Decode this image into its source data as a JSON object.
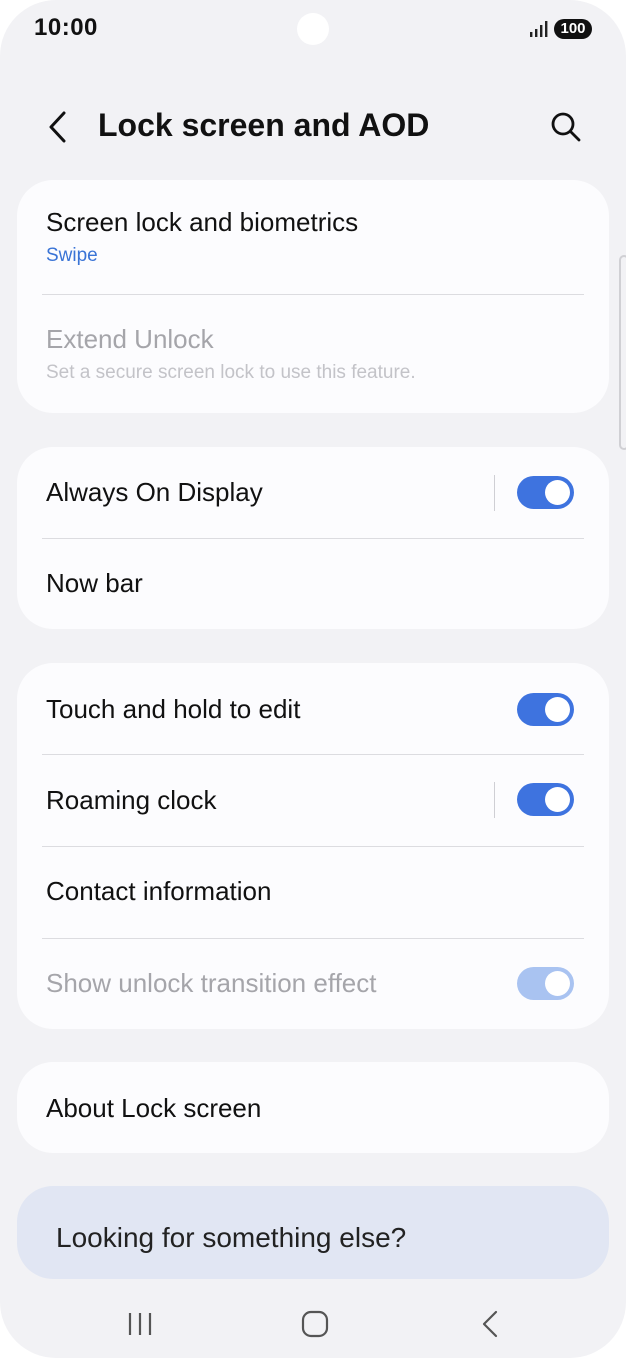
{
  "status_bar": {
    "time": "10:00",
    "battery": "100",
    "signal_icon": "signal-bars-icon"
  },
  "header": {
    "title": "Lock screen and AOD",
    "back_icon": "chevron-left-icon",
    "search_icon": "search-icon"
  },
  "security_card": {
    "screen_lock": {
      "title": "Screen lock and biometrics",
      "subtitle": "Swipe"
    },
    "extend_unlock": {
      "title": "Extend Unlock",
      "subtitle": "Set a secure screen lock to use this feature.",
      "enabled": false
    }
  },
  "display_card": {
    "always_on_display": {
      "title": "Always On Display",
      "toggle_on": true
    },
    "now_bar": {
      "title": "Now bar"
    }
  },
  "lock_options_card": {
    "touch_hold": {
      "title": "Touch and hold to edit",
      "toggle_on": true
    },
    "roaming_clock": {
      "title": "Roaming clock",
      "toggle_on": true
    },
    "contact_info": {
      "title": "Contact information"
    },
    "unlock_transition": {
      "title": "Show unlock transition effect",
      "toggle_on": true,
      "enabled": false
    }
  },
  "about_card": {
    "title": "About Lock screen"
  },
  "suggestion": {
    "text": "Looking for something else?"
  },
  "nav_bar": {
    "recents_icon": "recents-icon",
    "home_icon": "home-icon",
    "back_icon": "back-icon"
  },
  "colors": {
    "accent": "#3e73df",
    "link": "#3a74d6",
    "background": "#f2f2f5",
    "card": "#fcfcfe"
  }
}
